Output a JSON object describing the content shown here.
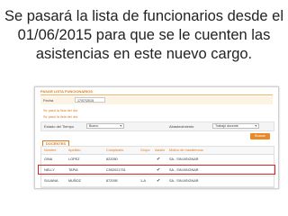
{
  "slide": {
    "title_line1": "Se pasará la lista de funcionarios desde el",
    "title_line2": "01/06/2015 para que se le cuenten las",
    "title_line3": "asistencias en este nuevo cargo."
  },
  "form": {
    "panel_title": "PASAR LISTA FUNCIONARIOS",
    "date_label": "Fecha",
    "date_value": "17/07/2015",
    "section1": "Se pasó la lista del día",
    "section2": "Se pasó la lista del día",
    "filter_label1": "Estado del Tiempo",
    "filter_value1": "Bueno",
    "filter_label2": "Abastecimiento",
    "filter_value2": "Trabajó docente",
    "search_label": "Buscar",
    "tab_label": "DOCENTES"
  },
  "grid": {
    "headers": [
      "Nombre",
      "Apellido",
      "Cumpleaño",
      "Grupo",
      "Asistió",
      "Motivo de Inasistencia"
    ],
    "rows": [
      {
        "nombre": "GINA",
        "apellido": "LOPEZ",
        "cumple": "822050",
        "grupo": "",
        "asistio": "✔",
        "motivo": "SA - SIN ASIGNAR"
      },
      {
        "nombre": "NELLY",
        "apellido": "TAPIA",
        "cumple": "C902021751",
        "grupo": "",
        "asistio": "✔",
        "motivo": "SA - SIN ASIGNAR"
      },
      {
        "nombre": "SILVANA",
        "apellido": "MUÑOZ",
        "cumple": "872095",
        "grupo": "1-A",
        "asistio": "✔",
        "motivo": "SA - SIN ASIGNAR"
      }
    ]
  },
  "colors": {
    "accent": "#e07a1f",
    "highlight": "#d8232a"
  }
}
